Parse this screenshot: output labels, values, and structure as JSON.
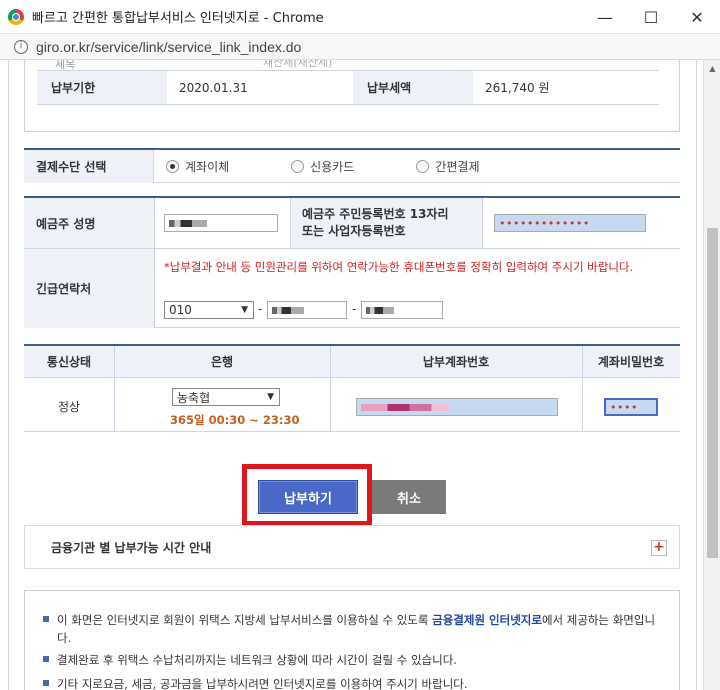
{
  "window": {
    "title": "빠르고 간편한 통합납부서비스 인터넷지로 - Chrome",
    "url": "giro.or.kr/service/link/service_link_index.do",
    "minimize": "—",
    "maximize": "☐",
    "close": "✕"
  },
  "bill": {
    "partial_label": "세목",
    "partial_value": "재산세(재산세)",
    "due_label": "납부기한",
    "due_value": "2020.01.31",
    "amount_label": "납부세액",
    "amount_value": "261,740 원"
  },
  "payment_method": {
    "label": "결제수단 선택",
    "options": [
      "계좌이체",
      "신용카드",
      "간편결제"
    ],
    "selected": "계좌이체"
  },
  "depositor": {
    "name_label": "예금주 성명",
    "id_label_line1": "예금주 주민등록번호 13자리",
    "id_label_line2": "또는 사업자등록번호",
    "id_value": "•••••••••••••",
    "contact_label": "긴급연락처",
    "contact_notice": "*납부결과 안내 등 민원관리를 위하여 연락가능한 휴대폰번호를 정확히 입력하여 주시기 바랍니다.",
    "phone_prefix": "010",
    "dash1": "-",
    "dash2": "-"
  },
  "account": {
    "col_status": "통신상태",
    "col_bank": "은행",
    "col_account_no": "납부계좌번호",
    "col_password": "계좌비밀번호",
    "status_value": "정상",
    "bank_value": "농축협",
    "hours": "365일 00:30 ~ 23:30",
    "password_value": "••••"
  },
  "buttons": {
    "pay": "납부하기",
    "cancel": "취소"
  },
  "info_bar": {
    "label": "금융기관 별 납부가능 시간 안내",
    "expand": "+"
  },
  "notes": {
    "n1_a": "이 화면은 인터넷지로 회원이 위택스 지방세 납부서비스를 이용하실 수 있도록 ",
    "n1_hl": "금융결제원 인터넷지로",
    "n1_b": "에서 제공하는 화면입니다.",
    "n2": "결제완료 후 위택스 수납처리까지는 네트워크 상황에 따라 시간이 걸릴 수 있습니다.",
    "n3": "기타 지로요금, 세금, 공과금을 납부하시려면 인터넷지로를 이용하여 주시기 바랍니다."
  },
  "colors": {
    "accent_blue": "#4a68c7",
    "header_bg": "#eef2f8",
    "highlight_red": "#e0161d"
  }
}
